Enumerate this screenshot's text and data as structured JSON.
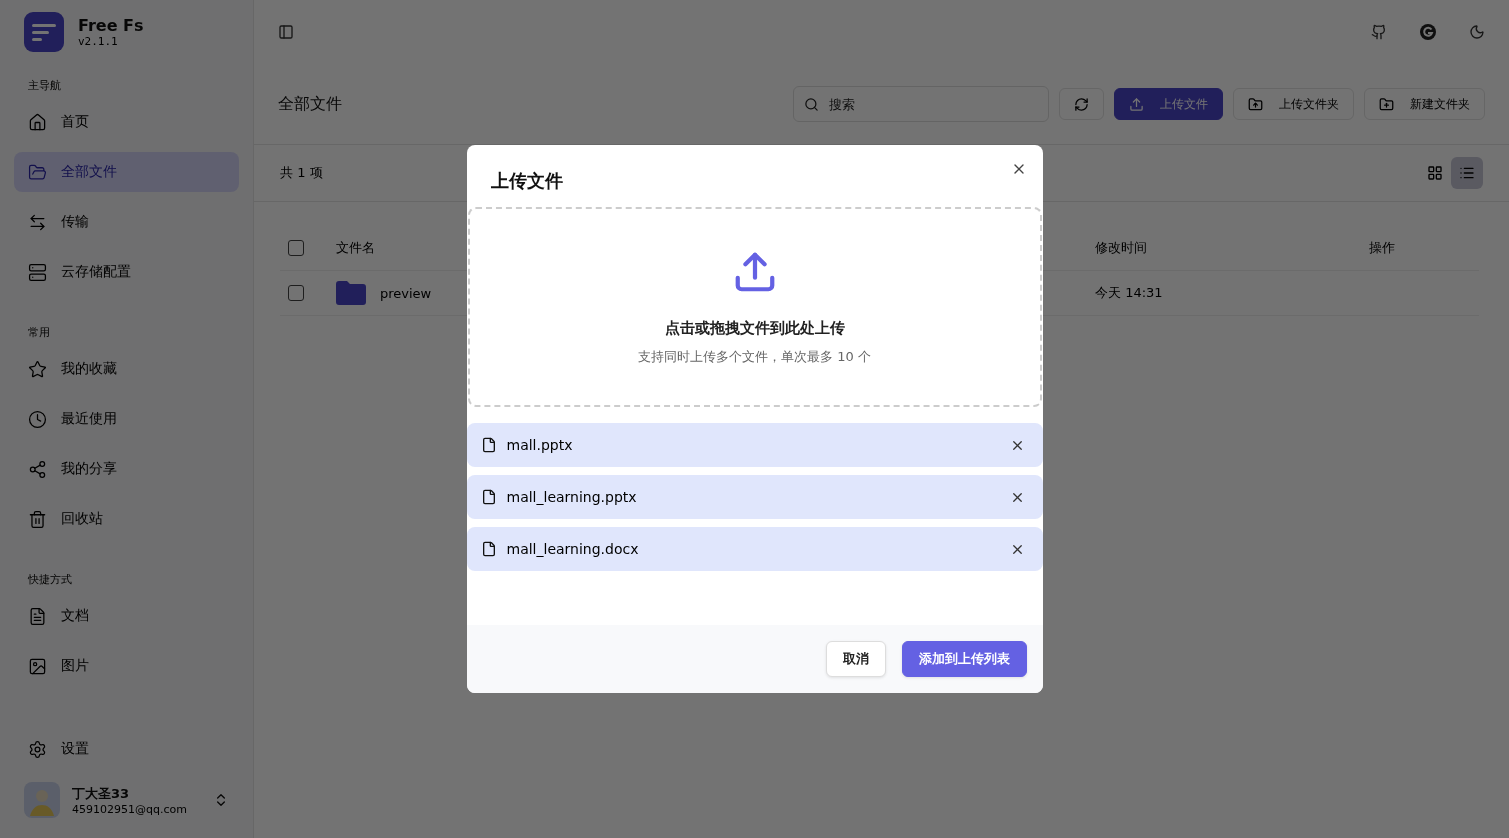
{
  "sidebar": {
    "app_name": "Free Fs",
    "version": "v2.1.1",
    "sections": [
      {
        "label": "主导航",
        "items": [
          {
            "label": "首页",
            "selected": false
          },
          {
            "label": "全部文件",
            "selected": true
          },
          {
            "label": "传输",
            "selected": false
          },
          {
            "label": "云存储配置",
            "selected": false
          }
        ]
      },
      {
        "label": "常用",
        "items": [
          {
            "label": "我的收藏",
            "selected": false
          },
          {
            "label": "最近使用",
            "selected": false
          },
          {
            "label": "我的分享",
            "selected": false
          },
          {
            "label": "回收站",
            "selected": false
          }
        ]
      },
      {
        "label": "快捷方式",
        "items": [
          {
            "label": "文档",
            "selected": false
          },
          {
            "label": "图片",
            "selected": false
          }
        ]
      }
    ],
    "settings": "设置",
    "user": {
      "name": "丁大圣33",
      "email": "459102951@qq.com"
    }
  },
  "toolbar": {
    "title": "全部文件",
    "search_placeholder": "搜索",
    "buttons": [
      {
        "label": "上传文件",
        "primary": true
      },
      {
        "label": "上传文件夹",
        "primary": false
      },
      {
        "label": "新建文件夹",
        "primary": false
      }
    ]
  },
  "summary": "共 1 项",
  "view_toggle": [
    {
      "selected": false
    },
    {
      "selected": true
    }
  ],
  "table": {
    "header_checked": false,
    "columns": [
      "文件名",
      "修改时间",
      "操作"
    ],
    "rows": [
      {
        "name": "preview",
        "modified": "今天 14:31",
        "checked": false
      }
    ]
  },
  "dialog": {
    "title": "上传文件",
    "drop_title": "点击或拖拽文件到此处上传",
    "drop_hint": "支持同时上传多个文件，单次最多 10 个",
    "files": [
      {
        "name": "mall.pptx"
      },
      {
        "name": "mall_learning.pptx"
      },
      {
        "name": "mall_learning.docx"
      }
    ],
    "cancel": "取消",
    "confirm": "添加到上传列表"
  }
}
